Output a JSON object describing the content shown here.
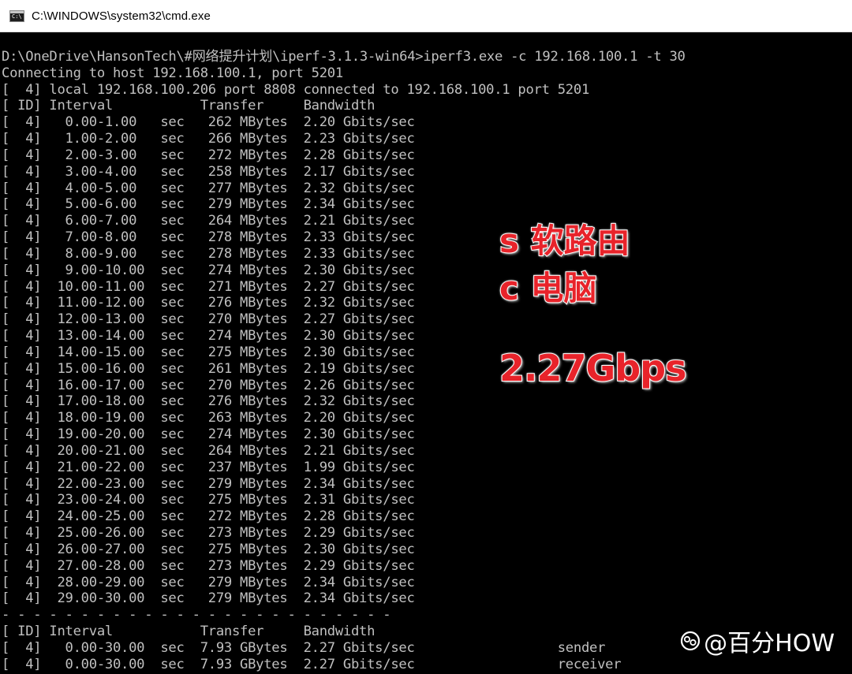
{
  "window": {
    "title": "C:\\WINDOWS\\system32\\cmd.exe",
    "icon_text": "C:\\"
  },
  "console": {
    "lines": [
      "D:\\OneDrive\\HansonTech\\#网络提升计划\\iperf-3.1.3-win64>iperf3.exe -c 192.168.100.1 -t 30",
      "Connecting to host 192.168.100.1, port 5201",
      "[  4] local 192.168.100.206 port 8808 connected to 192.168.100.1 port 5201",
      "[ ID] Interval           Transfer     Bandwidth",
      "[  4]   0.00-1.00   sec   262 MBytes  2.20 Gbits/sec",
      "[  4]   1.00-2.00   sec   266 MBytes  2.23 Gbits/sec",
      "[  4]   2.00-3.00   sec   272 MBytes  2.28 Gbits/sec",
      "[  4]   3.00-4.00   sec   258 MBytes  2.17 Gbits/sec",
      "[  4]   4.00-5.00   sec   277 MBytes  2.32 Gbits/sec",
      "[  4]   5.00-6.00   sec   279 MBytes  2.34 Gbits/sec",
      "[  4]   6.00-7.00   sec   264 MBytes  2.21 Gbits/sec",
      "[  4]   7.00-8.00   sec   278 MBytes  2.33 Gbits/sec",
      "[  4]   8.00-9.00   sec   278 MBytes  2.33 Gbits/sec",
      "[  4]   9.00-10.00  sec   274 MBytes  2.30 Gbits/sec",
      "[  4]  10.00-11.00  sec   271 MBytes  2.27 Gbits/sec",
      "[  4]  11.00-12.00  sec   276 MBytes  2.32 Gbits/sec",
      "[  4]  12.00-13.00  sec   270 MBytes  2.27 Gbits/sec",
      "[  4]  13.00-14.00  sec   274 MBytes  2.30 Gbits/sec",
      "[  4]  14.00-15.00  sec   275 MBytes  2.30 Gbits/sec",
      "[  4]  15.00-16.00  sec   261 MBytes  2.19 Gbits/sec",
      "[  4]  16.00-17.00  sec   270 MBytes  2.26 Gbits/sec",
      "[  4]  17.00-18.00  sec   276 MBytes  2.32 Gbits/sec",
      "[  4]  18.00-19.00  sec   263 MBytes  2.20 Gbits/sec",
      "[  4]  19.00-20.00  sec   274 MBytes  2.30 Gbits/sec",
      "[  4]  20.00-21.00  sec   264 MBytes  2.21 Gbits/sec",
      "[  4]  21.00-22.00  sec   237 MBytes  1.99 Gbits/sec",
      "[  4]  22.00-23.00  sec   279 MBytes  2.34 Gbits/sec",
      "[  4]  23.00-24.00  sec   275 MBytes  2.31 Gbits/sec",
      "[  4]  24.00-25.00  sec   272 MBytes  2.28 Gbits/sec",
      "[  4]  25.00-26.00  sec   273 MBytes  2.29 Gbits/sec",
      "[  4]  26.00-27.00  sec   275 MBytes  2.30 Gbits/sec",
      "[  4]  27.00-28.00  sec   273 MBytes  2.29 Gbits/sec",
      "[  4]  28.00-29.00  sec   279 MBytes  2.34 Gbits/sec",
      "[  4]  29.00-30.00  sec   279 MBytes  2.34 Gbits/sec",
      "- - - - - - - - - - - - - - - - - - - - - - - - -",
      "[ ID] Interval           Transfer     Bandwidth",
      "[  4]   0.00-30.00  sec  7.93 GBytes  2.27 Gbits/sec                  sender",
      "[  4]   0.00-30.00  sec  7.93 GBytes  2.27 Gbits/sec                  receiver"
    ]
  },
  "annotations": {
    "server_label": "s 软路由",
    "client_label": "c 电脑",
    "speed_label": "2.27Gbps"
  },
  "watermark": {
    "text": "@百分HOW",
    "logo_icon": "toutiao-logo-icon"
  },
  "colors": {
    "console_text": "#c0c0c0",
    "console_bg": "#000000",
    "annotation_red": "#e8232a"
  }
}
